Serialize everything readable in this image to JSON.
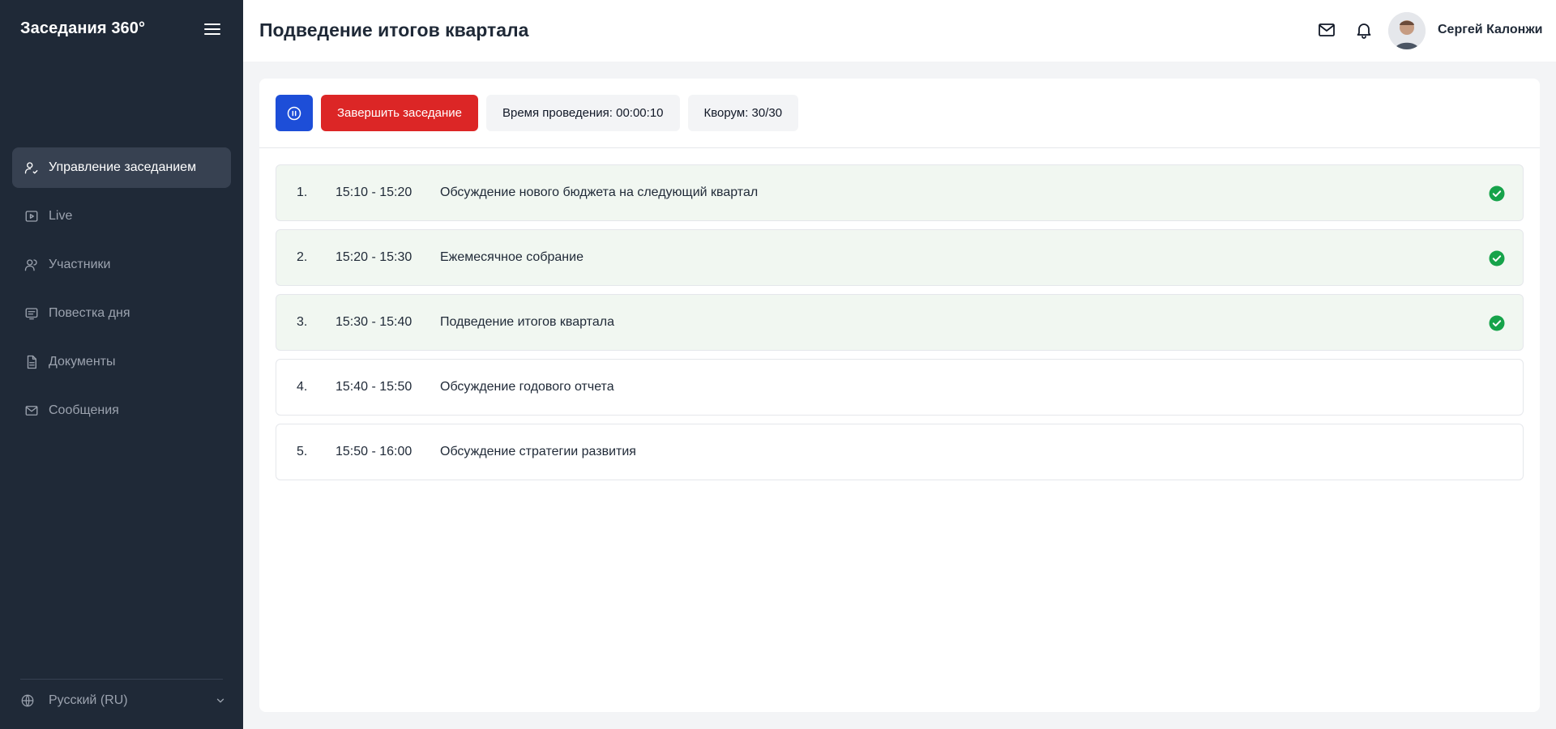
{
  "app": {
    "brand": "Заседания 360°"
  },
  "sidebar": {
    "items": [
      {
        "label": "Управление заседанием",
        "icon": "user-manage-icon",
        "active": true
      },
      {
        "label": "Live",
        "icon": "play-screen-icon",
        "active": false
      },
      {
        "label": "Участники",
        "icon": "users-icon",
        "active": false
      },
      {
        "label": "Повестка дня",
        "icon": "agenda-icon",
        "active": false
      },
      {
        "label": "Документы",
        "icon": "document-icon",
        "active": false
      },
      {
        "label": "Сообщения",
        "icon": "mail-icon",
        "active": false
      }
    ],
    "language": {
      "label": "Русский (RU)",
      "icon": "globe-icon"
    }
  },
  "header": {
    "title": "Подведение итогов квартала",
    "icons": [
      "mail-icon",
      "bell-icon"
    ],
    "user": {
      "name": "Сергей Калонжи"
    }
  },
  "controls": {
    "pause_icon": "pause-icon",
    "end_label": "Завершить заседание",
    "duration_label": "Время проведения: 00:00:10",
    "quorum_label": "Кворум: 30/30"
  },
  "agenda": [
    {
      "num": "1.",
      "time": "15:10 - 15:20",
      "title": "Обсуждение нового бюджета на следующий квартал",
      "done": true
    },
    {
      "num": "2.",
      "time": "15:20 - 15:30",
      "title": "Ежемесячное собрание",
      "done": true
    },
    {
      "num": "3.",
      "time": "15:30 - 15:40",
      "title": "Подведение итогов квартала",
      "done": true
    },
    {
      "num": "4.",
      "time": "15:40 - 15:50",
      "title": "Обсуждение годового отчета",
      "done": false
    },
    {
      "num": "5.",
      "time": "15:50 - 16:00",
      "title": "Обсуждение стратегии развития",
      "done": false
    }
  ],
  "colors": {
    "sidebar_bg": "#1f2937",
    "active_item_bg": "#374151",
    "primary": "#1d4ed8",
    "danger": "#dc2626",
    "success": "#16a34a",
    "done_row_bg": "#f1f7f1"
  }
}
